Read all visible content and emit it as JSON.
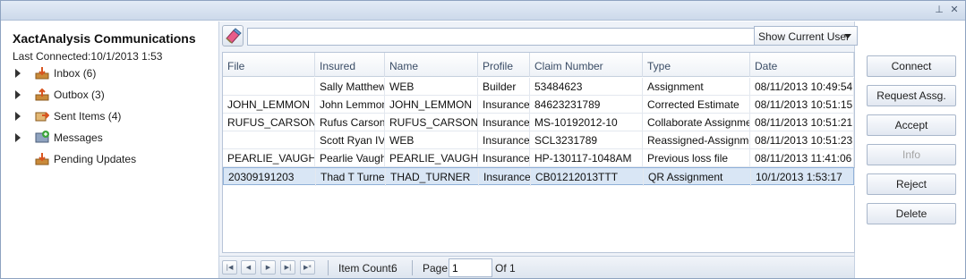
{
  "titlebar": {
    "pin_icon": "pin-icon",
    "close_icon": "close-icon"
  },
  "sidebar": {
    "title": "XactAnalysis Communications",
    "last_connected": "Last Connected:10/1/2013 1:53",
    "items": [
      {
        "label": "Inbox (6)",
        "icon": "inbox-icon",
        "expandable": true
      },
      {
        "label": "Outbox (3)",
        "icon": "outbox-icon",
        "expandable": true
      },
      {
        "label": "Sent Items (4)",
        "icon": "sent-items-icon",
        "expandable": true
      },
      {
        "label": "Messages",
        "icon": "messages-icon",
        "expandable": true
      },
      {
        "label": "Pending Updates",
        "icon": "pending-updates-icon",
        "expandable": false
      }
    ]
  },
  "toolbar": {
    "eraser_icon": "eraser-icon",
    "search_value": "",
    "user_filter": "Show Current User"
  },
  "grid": {
    "columns": [
      "File",
      "Insured",
      "Name",
      "Profile",
      "Claim Number",
      "Type",
      "Date"
    ],
    "rows": [
      [
        "",
        "Sally Matthews",
        "WEB",
        "Builder",
        "53484623",
        "Assignment",
        "08/11/2013 10:49:54"
      ],
      [
        "JOHN_LEMMON",
        "John Lemmon",
        "JOHN_LEMMON",
        "Insurance",
        "84623231789",
        "Corrected Estimate",
        "08/11/2013 10:51:15"
      ],
      [
        "RUFUS_CARSON",
        "Rufus Carson",
        "RUFUS_CARSON",
        "Insurance",
        "MS-10192012-10",
        "Collaborate Assignment",
        "08/11/2013 10:51:21"
      ],
      [
        "",
        "Scott Ryan IV",
        "WEB",
        "Insurance",
        "SCL3231789",
        "Reassigned-Assignment",
        "08/11/2013 10:51:23"
      ],
      [
        "PEARLIE_VAUGH",
        "Pearlie Vaugh",
        "PEARLIE_VAUGH",
        "Insurance",
        "HP-130117-1048AM",
        "Previous loss file",
        "08/11/2013 11:41:06"
      ],
      [
        "20309191203",
        "Thad T Turner",
        "THAD_TURNER",
        "Insurance",
        "CB01212013TTT",
        "QR Assignment",
        "10/1/2013 1:53:17"
      ]
    ],
    "selected_row": 5
  },
  "pager": {
    "item_count_label": "Item Count:",
    "item_count": "6",
    "page_label": "Page",
    "page_value": "1",
    "of_label": "Of 1"
  },
  "actions": [
    {
      "label": "Connect",
      "enabled": true
    },
    {
      "label": "Request Assg.",
      "enabled": true
    },
    {
      "label": "Accept",
      "enabled": true
    },
    {
      "label": "Info",
      "enabled": false
    },
    {
      "label": "Reject",
      "enabled": true
    },
    {
      "label": "Delete",
      "enabled": true
    }
  ],
  "colors": {
    "selection": "#d9e6f5",
    "border": "#8ea3c0",
    "panel": "#eef2f8"
  }
}
